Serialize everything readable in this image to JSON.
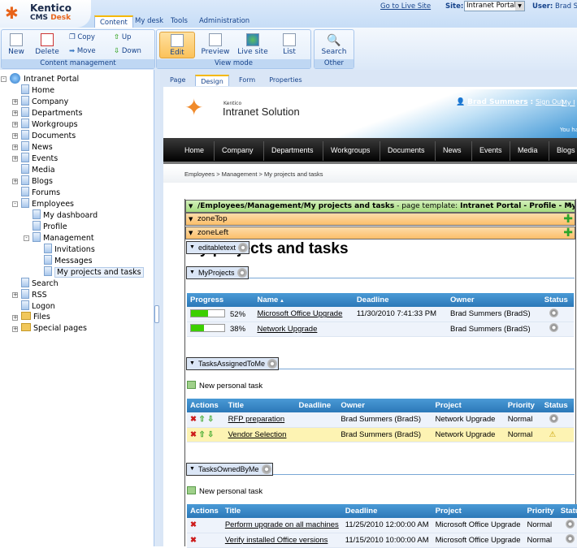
{
  "header": {
    "brand_top": "Kentico",
    "brand_cms": "CMS ",
    "brand_desk": "Desk",
    "tabs": [
      "Content",
      "My desk",
      "Tools",
      "Administration"
    ],
    "active_tab": "Content",
    "go_live": "Go to Live Site",
    "site_label": "Site:",
    "site_value": "Intranet Portal",
    "user_label": "User:",
    "user_value": "Brad S"
  },
  "ribbon": {
    "content_management": {
      "label": "Content management",
      "new": "New",
      "delete": "Delete",
      "copy": "Copy",
      "move": "Move",
      "up": "Up",
      "down": "Down"
    },
    "view_mode": {
      "label": "View mode",
      "edit": "Edit",
      "preview": "Preview",
      "live_site": "Live site",
      "list": "List"
    },
    "other": {
      "label": "Other",
      "search": "Search"
    }
  },
  "tree": [
    {
      "label": "Intranet Portal",
      "level": 0,
      "icon": "globe",
      "toggle": "-"
    },
    {
      "label": "Home",
      "level": 1,
      "icon": "page"
    },
    {
      "label": "Company",
      "level": 1,
      "icon": "page",
      "toggle": "+"
    },
    {
      "label": "Departments",
      "level": 1,
      "icon": "page",
      "toggle": "+"
    },
    {
      "label": "Workgroups",
      "level": 1,
      "icon": "page",
      "toggle": "+"
    },
    {
      "label": "Documents",
      "level": 1,
      "icon": "page",
      "toggle": "+"
    },
    {
      "label": "News",
      "level": 1,
      "icon": "page",
      "toggle": "+"
    },
    {
      "label": "Events",
      "level": 1,
      "icon": "page",
      "toggle": "+"
    },
    {
      "label": "Media",
      "level": 1,
      "icon": "page"
    },
    {
      "label": "Blogs",
      "level": 1,
      "icon": "page",
      "toggle": "+"
    },
    {
      "label": "Forums",
      "level": 1,
      "icon": "page"
    },
    {
      "label": "Employees",
      "level": 1,
      "icon": "page",
      "toggle": "-"
    },
    {
      "label": "My dashboard",
      "level": 2,
      "icon": "page"
    },
    {
      "label": "Profile",
      "level": 2,
      "icon": "page"
    },
    {
      "label": "Management",
      "level": 2,
      "icon": "page",
      "toggle": "-"
    },
    {
      "label": "Invitations",
      "level": 3,
      "icon": "page"
    },
    {
      "label": "Messages",
      "level": 3,
      "icon": "page"
    },
    {
      "label": "My projects and tasks",
      "level": 3,
      "icon": "page",
      "selected": true
    },
    {
      "label": "Search",
      "level": 1,
      "icon": "page"
    },
    {
      "label": "RSS",
      "level": 1,
      "icon": "page",
      "toggle": "+"
    },
    {
      "label": "Logon",
      "level": 1,
      "icon": "page"
    },
    {
      "label": "Files",
      "level": 1,
      "icon": "folder",
      "toggle": "+"
    },
    {
      "label": "Special pages",
      "level": 1,
      "icon": "folder",
      "toggle": "+"
    }
  ],
  "page_tabs": [
    "Page",
    "Design",
    "Form",
    "Properties"
  ],
  "active_page_tab": "Design",
  "site": {
    "logo_small": "Kentico",
    "logo_big": "Intranet Solution",
    "user_link": "Brad Summers",
    "sep": ":",
    "sign_out": "Sign Out",
    "my": "My I",
    "you_have": "You ha",
    "nav": [
      "Home",
      "Company",
      "Departments",
      "Workgroups",
      "Documents",
      "News",
      "Events",
      "Media",
      "Blogs"
    ],
    "breadcrumb": [
      "Employees",
      "Management",
      "My projects and tasks"
    ]
  },
  "design": {
    "path": "/Employees/Management/My projects and tasks",
    "template_prefix": " - page template: ",
    "template": "Intranet Portal - Profile - My tasks",
    "zone_top": "zoneTop",
    "zone_left": "zoneLeft",
    "editabletext": "editabletext",
    "heading": "My projects and tasks"
  },
  "my_projects": {
    "webpart": "MyProjects",
    "columns": [
      "Progress",
      "Name",
      "Deadline",
      "Owner",
      "Status"
    ],
    "sort_indicator": "▲",
    "rows": [
      {
        "progress": 52,
        "progress_label": "52%",
        "name": "Microsoft Office Upgrade",
        "deadline": "11/30/2010 7:41:33 PM",
        "owner": "Brad Summers (BradS)",
        "status": "in-progress"
      },
      {
        "progress": 38,
        "progress_label": "38%",
        "name": "Network Upgrade",
        "deadline": "",
        "owner": "Brad Summers (BradS)",
        "status": "in-progress"
      }
    ]
  },
  "tasks_assigned": {
    "webpart": "TasksAssignedToMe",
    "new_task": "New personal task",
    "columns": [
      "Actions",
      "Title",
      "Deadline",
      "Owner",
      "Project",
      "Priority",
      "Status"
    ],
    "rows": [
      {
        "title": "RFP preparation",
        "deadline": "",
        "owner": "Brad Summers (BradS)",
        "project": "Network Upgrade",
        "priority": "Normal",
        "status": "in-progress"
      },
      {
        "title": "Vendor Selection",
        "deadline": "",
        "owner": "Brad Summers (BradS)",
        "project": "Network Upgrade",
        "priority": "Normal",
        "status": "warning",
        "highlight": true
      }
    ]
  },
  "tasks_owned": {
    "webpart": "TasksOwnedByMe",
    "new_task": "New personal task",
    "columns": [
      "Actions",
      "Title",
      "Deadline",
      "Project",
      "Priority",
      "Status"
    ],
    "rows": [
      {
        "title": "Perform upgrade on all machines",
        "deadline": "11/25/2010 12:00:00 AM",
        "project": "Microsoft Office Upgrade",
        "priority": "Normal",
        "status": "in-progress"
      },
      {
        "title": "Verify installed Office versions",
        "deadline": "11/15/2010 10:00:00 AM",
        "project": "Microsoft Office Upgrade",
        "priority": "Normal",
        "status": "in-progress"
      }
    ]
  },
  "colors": {
    "accent_orange": "#f5b800",
    "zone_orange": "#fbc87a",
    "template_green": "#b8e59a",
    "table_header": "#2c78b8",
    "highlight_row": "#fdf3b3"
  }
}
